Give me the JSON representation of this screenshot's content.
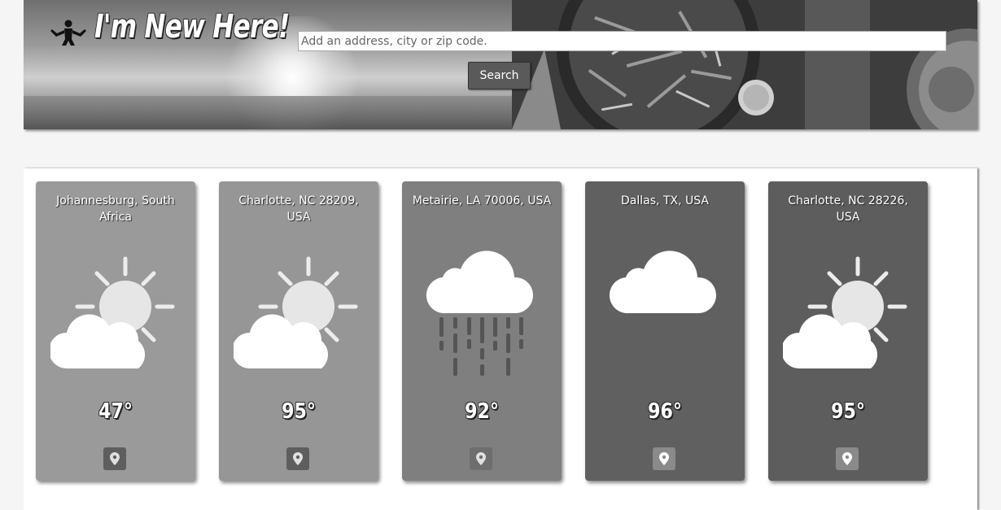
{
  "header": {
    "title": "I'm New Here!",
    "brand_icon": "shrug-person-icon"
  },
  "search": {
    "placeholder": "Add an address, city or zip code.",
    "value": "",
    "button_label": "Search"
  },
  "cards": [
    {
      "location": "Johannesburg, South Africa",
      "temperature": "47°",
      "condition_icon": "partly-cloudy-icon",
      "bg": "#9a9a9a",
      "pin_bg": "#5e5e5e"
    },
    {
      "location": "Charlotte, NC 28209, USA",
      "temperature": "95°",
      "condition_icon": "partly-cloudy-icon",
      "bg": "#969696",
      "pin_bg": "#5e5e5e"
    },
    {
      "location": "Metairie, LA 70006, USA",
      "temperature": "92°",
      "condition_icon": "rain-icon",
      "bg": "#7f7f7f",
      "pin_bg": "#6e6e6e"
    },
    {
      "location": "Dallas, TX, USA",
      "temperature": "96°",
      "condition_icon": "cloud-icon",
      "bg": "#606060",
      "pin_bg": "#8a8a8a"
    },
    {
      "location": "Charlotte, NC 28226, USA",
      "temperature": "95°",
      "condition_icon": "partly-cloudy-icon",
      "bg": "#5d5d5d",
      "pin_bg": "#8a8a8a"
    }
  ],
  "icons": {
    "pin": "map-pin-icon"
  }
}
